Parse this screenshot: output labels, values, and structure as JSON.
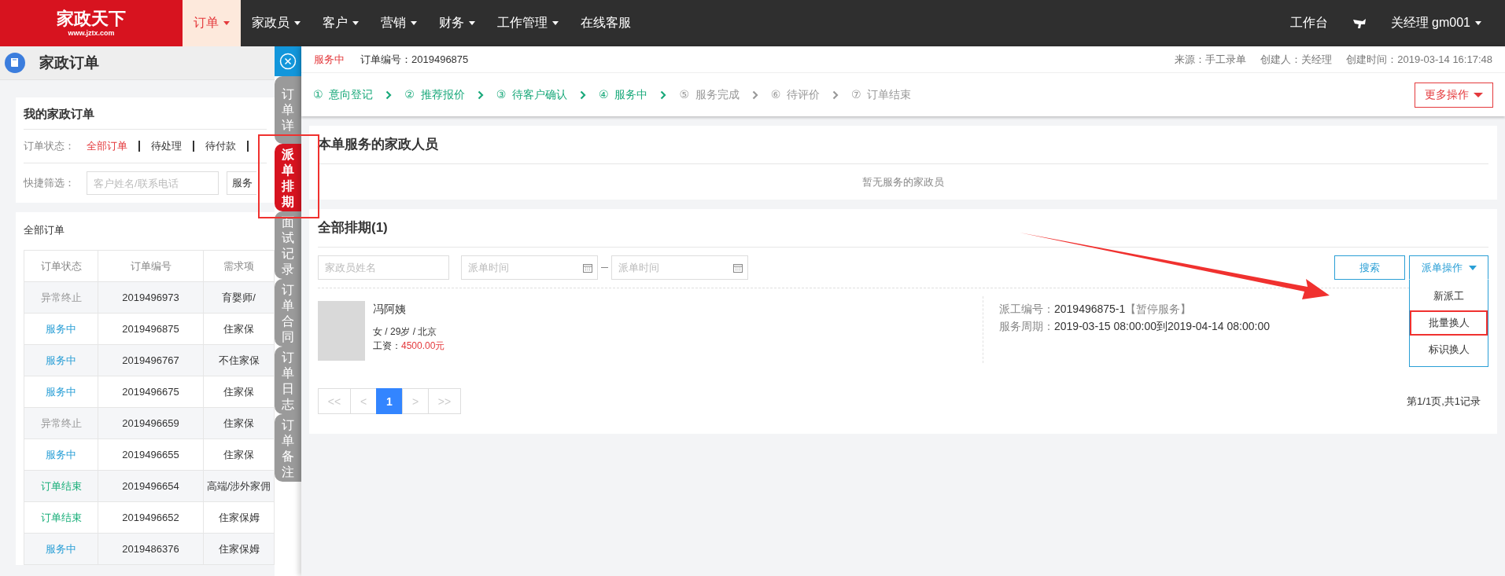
{
  "top_nav": {
    "logo": {
      "name": "家政天下",
      "url": "www.jztx.com"
    },
    "items": [
      {
        "label": "订单",
        "selected": true,
        "has_menu": true
      },
      {
        "label": "家政员",
        "selected": false,
        "has_menu": true
      },
      {
        "label": "客户",
        "selected": false,
        "has_menu": true
      },
      {
        "label": "营销",
        "selected": false,
        "has_menu": true
      },
      {
        "label": "财务",
        "selected": false,
        "has_menu": true
      },
      {
        "label": "工作管理",
        "selected": false,
        "has_menu": true
      },
      {
        "label": "在线客服",
        "selected": false,
        "has_menu": false
      }
    ],
    "workbench": "工作台",
    "user": "关经理  gm001"
  },
  "left_panel": {
    "title": "家政订单",
    "filter_card": {
      "title": "我的家政订单",
      "status_label": "订单状态：",
      "statuses": [
        {
          "label": "全部订单",
          "selected": true
        },
        {
          "label": "待处理",
          "selected": false
        },
        {
          "label": "待付款",
          "selected": false
        }
      ],
      "quick_filter_label": "快捷筛选：",
      "search": {
        "placeholder": "客户姓名/联系电话"
      },
      "select": {
        "value": "服务"
      }
    },
    "orders": {
      "title": "全部订单",
      "columns": [
        "订单状态",
        "订单编号",
        "需求项"
      ],
      "rows": [
        {
          "status": "异常终止",
          "color": "#999999",
          "number": "2019496973",
          "demand": "育婴师/"
        },
        {
          "status": "服务中",
          "color": "#2a9fd6",
          "number": "2019496875",
          "demand": "住家保"
        },
        {
          "status": "服务中",
          "color": "#2a9fd6",
          "number": "2019496767",
          "demand": "不住家保"
        },
        {
          "status": "服务中",
          "color": "#2a9fd6",
          "number": "2019496675",
          "demand": "住家保"
        },
        {
          "status": "异常终止",
          "color": "#999999",
          "number": "2019496659",
          "demand": "住家保"
        },
        {
          "status": "服务中",
          "color": "#2a9fd6",
          "number": "2019496655",
          "demand": "住家保"
        },
        {
          "status": "订单结束",
          "color": "#1aaf7a",
          "number": "2019496654",
          "demand": "高端/涉外家佣"
        },
        {
          "status": "订单结束",
          "color": "#1aaf7a",
          "number": "2019496652",
          "demand": "住家保姆"
        },
        {
          "status": "服务中",
          "color": "#2a9fd6",
          "number": "2019486376",
          "demand": "住家保姆"
        }
      ]
    }
  },
  "drawer": {
    "tabs": [
      {
        "label": "订单详",
        "selected": false
      },
      {
        "label": "派单排期",
        "selected": true
      },
      {
        "label": "面试记录",
        "selected": false
      },
      {
        "label": "订单合同",
        "selected": false
      },
      {
        "label": "订单日志",
        "selected": false
      },
      {
        "label": "订单备注",
        "selected": false
      }
    ],
    "header": {
      "status": "服务中",
      "order_no": "订单编号：2019496875",
      "source": "来源：手工录单",
      "creator": "创建人：关经理",
      "created": "创建时间：2019-03-14 16:17:48"
    },
    "steps": [
      {
        "number": "①",
        "label": "意向登记",
        "done": true
      },
      {
        "number": "②",
        "label": "推荐报价",
        "done": true
      },
      {
        "number": "③",
        "label": "待客户确认",
        "done": true
      },
      {
        "number": "④",
        "label": "服务中",
        "done": true
      },
      {
        "number": "⑤",
        "label": "服务完成",
        "done": false
      },
      {
        "number": "⑥",
        "label": "待评价",
        "done": false
      },
      {
        "number": "⑦",
        "label": "订单结束",
        "done": false
      }
    ],
    "more_button": "更多操作",
    "staff_card": {
      "title": "本单服务的家政人员",
      "empty": "暂无服务的家政员"
    },
    "schedule": {
      "title": "全部排期(1)",
      "name_field": {
        "placeholder": "家政员姓名"
      },
      "date_from": {
        "placeholder": "派单时间"
      },
      "date_to": {
        "placeholder": "派单时间"
      },
      "search_button": "搜索",
      "dispatch_menu": {
        "label": "派单操作",
        "expanded": true,
        "items": [
          {
            "label": "新派工",
            "highlighted": false
          },
          {
            "label": "批量换人",
            "highlighted": true
          },
          {
            "label": "标识换人",
            "highlighted": false
          }
        ]
      },
      "entries": [
        {
          "name": "冯阿姨",
          "info": "女 / 29岁 / 北京",
          "salary_label": "工资：",
          "salary": "4500.00元",
          "dispatch_label": "派工编号：",
          "dispatch_no": "2019496875-1",
          "dispatch_status": "【暂停服务】",
          "period_label": "服务周期：",
          "period": "2019-03-15 08:00:00到2019-04-14 08:00:00"
        }
      ],
      "pagination": [
        {
          "label": "<<",
          "selected": false
        },
        {
          "label": "<",
          "selected": false
        },
        {
          "label": "1",
          "selected": true
        },
        {
          "label": ">",
          "selected": false
        },
        {
          "label": ">>",
          "selected": false
        }
      ],
      "summary": "第1/1页,共1记录"
    }
  }
}
